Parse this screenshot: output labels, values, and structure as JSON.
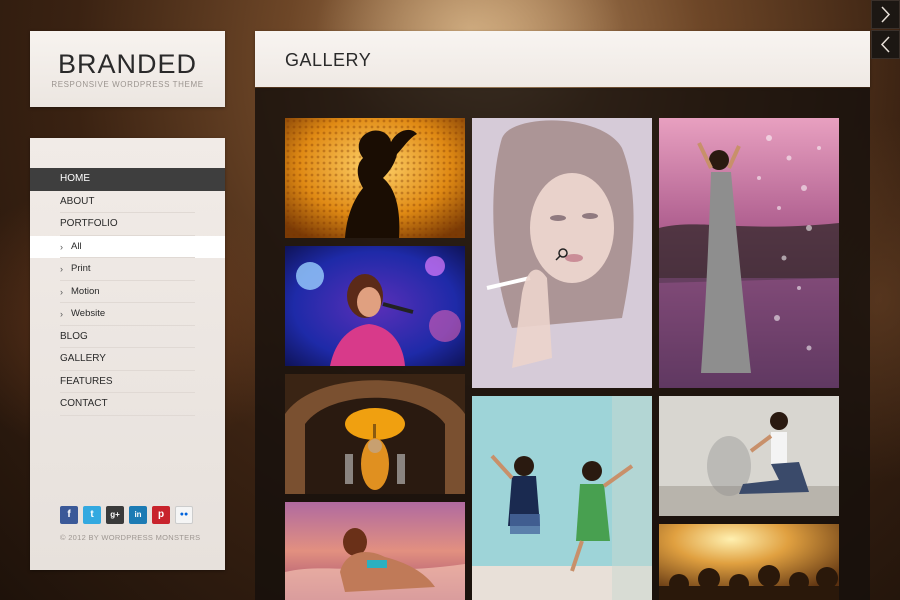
{
  "logo": {
    "title": "BRANDED",
    "subtitle": "RESPONSIVE WORDPRESS THEME"
  },
  "nav": {
    "items": [
      {
        "label": "HOME",
        "state": "active"
      },
      {
        "label": "ABOUT"
      },
      {
        "label": "PORTFOLIO"
      },
      {
        "label": "All",
        "sub": true,
        "state": "selected"
      },
      {
        "label": "Print",
        "sub": true
      },
      {
        "label": "Motion",
        "sub": true
      },
      {
        "label": "Website",
        "sub": true
      },
      {
        "label": "BLOG"
      },
      {
        "label": "GALLERY"
      },
      {
        "label": "FEATURES"
      },
      {
        "label": "CONTACT"
      }
    ]
  },
  "social": [
    {
      "name": "facebook-icon",
      "glyph": "f",
      "color": "#3b5998"
    },
    {
      "name": "twitter-icon",
      "glyph": "t",
      "color": "#33a9e0"
    },
    {
      "name": "google-plus-icon",
      "glyph": "g+",
      "color": "#3a3a3a"
    },
    {
      "name": "linkedin-icon",
      "glyph": "in",
      "color": "#1c7bb4"
    },
    {
      "name": "pinterest-icon",
      "glyph": "p",
      "color": "#c8232c"
    },
    {
      "name": "flickr-icon",
      "glyph": "●●",
      "color": "#f5f5f5"
    }
  ],
  "copyright": "© 2012 BY WORDPRESS MONSTERS",
  "page": {
    "title": "GALLERY"
  },
  "gallery": [
    {
      "name": "gallery-tile-silhouette"
    },
    {
      "name": "gallery-tile-smoking-woman"
    },
    {
      "name": "gallery-tile-lake-dress"
    },
    {
      "name": "gallery-tile-singer"
    },
    {
      "name": "gallery-tile-statue"
    },
    {
      "name": "gallery-tile-jumping-girls"
    },
    {
      "name": "gallery-tile-sitting-woman"
    },
    {
      "name": "gallery-tile-beach"
    },
    {
      "name": "gallery-tile-concert"
    }
  ],
  "nav_arrows": {
    "next": "next-arrow-icon",
    "prev": "prev-arrow-icon"
  }
}
